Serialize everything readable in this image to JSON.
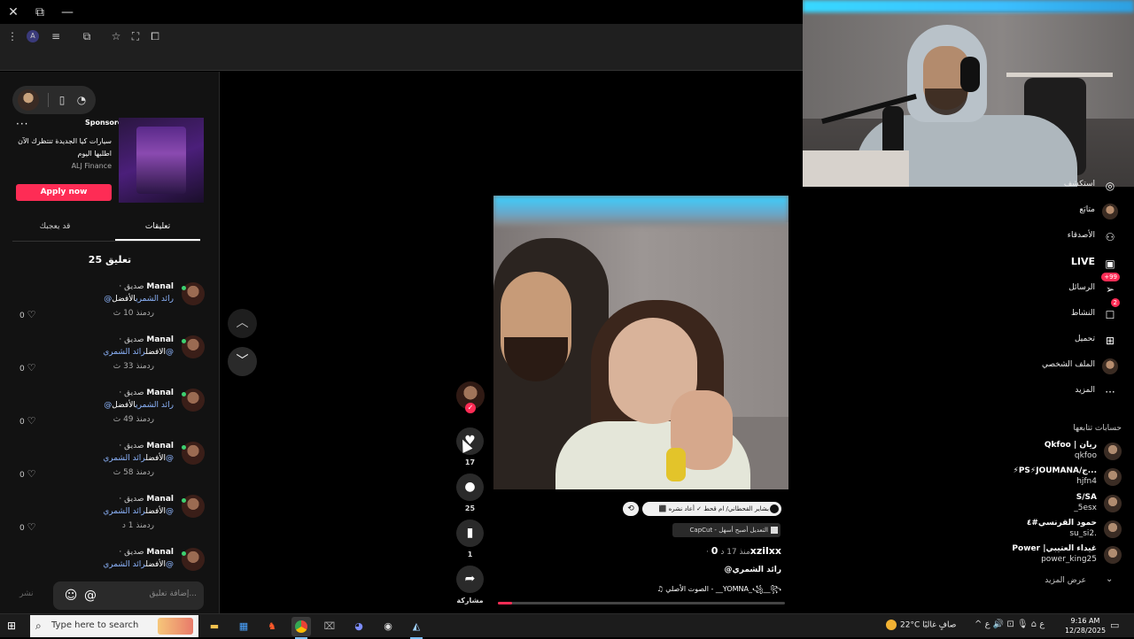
{
  "browser": {
    "close_glyph": "✕",
    "restore_glyph": "⧉",
    "minimize_glyph": "—",
    "menu_glyph": "⋮",
    "toolbar_icons": [
      "profile-icon",
      "media-control-icon",
      "extensions-icon",
      "bookmark-star-icon",
      "screenshot-icon",
      "split-view-icon"
    ]
  },
  "left_panel": {
    "ad": {
      "more": "···",
      "sponsored": "Sponsored",
      "headline": "سيارات كيا الجديدة تنتظرك الآن اطلبها اليوم",
      "brand": "ALJ Finance",
      "cta": "Apply now"
    },
    "tabs": {
      "comments": "تعليقات",
      "you_may_like": "قد يعجبك"
    },
    "comment_count": "25 تعليق",
    "comments": [
      {
        "name": "Manal",
        "relation": "· صديق",
        "text_mention": "@رائد الشمري",
        "text_plain": "الأفضل",
        "order": "plain-first",
        "time": "منذ 10 ث",
        "reply": "رد",
        "likes": "0"
      },
      {
        "name": "Manal",
        "relation": "· صديق",
        "text_mention": "رائد الشمري@",
        "text_plain": "الافضل",
        "order": "mention-first",
        "time": "منذ 33 ث",
        "reply": "رد",
        "likes": "0"
      },
      {
        "name": "Manal",
        "relation": "· صديق",
        "text_mention": "@رائد الشمري",
        "text_plain": "الأفضل",
        "order": "plain-first",
        "time": "منذ 49 ث",
        "reply": "رد",
        "likes": "0"
      },
      {
        "name": "Manal",
        "relation": "· صديق",
        "text_mention": "رائد الشمري@",
        "text_plain": "الأفضل",
        "order": "mention-first",
        "time": "منذ 58 ث",
        "reply": "رد",
        "likes": "0"
      },
      {
        "name": "Manal",
        "relation": "· صديق",
        "text_mention": "رائد الشمري@",
        "text_plain": "الأفضل",
        "order": "mention-first",
        "time": "منذ 1 د",
        "reply": "رد",
        "likes": "0"
      },
      {
        "name": "Manal",
        "relation": "· صديق",
        "text_mention": "رائد الشمري@",
        "text_plain": "الأفضل",
        "order": "mention-first",
        "time": "",
        "reply": "",
        "likes": ""
      }
    ],
    "comment_input_placeholder": "إضافة تعليق...",
    "post_label": "نشر",
    "emoji_glyph": "☺",
    "mention_glyph": "@"
  },
  "video": {
    "actions": {
      "likes": "17",
      "comments": "25",
      "saves": "1",
      "share_label": "مشاركة"
    },
    "repost_text": "⬛ بشاير القحطاني/ ام قحط ✓ أعاد نشره",
    "capcut_text": "CapCut - التعديل أصبح أسهل",
    "author": "0xzilxx",
    "author_time": " · منذ 17 د",
    "mention": "@رائد الشمري",
    "music": "♫  الصوت الأصلي - __YOMNA_꧁__꧂",
    "progress": 0.05
  },
  "right_sidebar": {
    "nav": [
      {
        "label": "استكشف",
        "icon": "explore-icon",
        "glyph": "◎",
        "badge": ""
      },
      {
        "label": "متابَع",
        "icon": "following-avatar-icon",
        "glyph": "●",
        "badge": ""
      },
      {
        "label": "الأصدقاء",
        "icon": "friends-icon",
        "glyph": "⚇",
        "badge": ""
      },
      {
        "label": "LIVE",
        "icon": "live-icon",
        "glyph": "▣",
        "badge": "",
        "big": true
      },
      {
        "label": "الرسائل",
        "icon": "messages-icon",
        "glyph": "➢",
        "badge": "+99"
      },
      {
        "label": "النشاط",
        "icon": "activity-icon",
        "glyph": "☐",
        "badge": "2"
      },
      {
        "label": "تحميل",
        "icon": "upload-icon",
        "glyph": "⊞",
        "badge": ""
      },
      {
        "label": "الملف الشخصي",
        "icon": "profile-avatar-icon",
        "glyph": "●",
        "badge": ""
      },
      {
        "label": "المزيد",
        "icon": "more-icon",
        "glyph": "···",
        "badge": ""
      }
    ],
    "following_title": "حسابات تتابعها",
    "following": [
      {
        "name": "Qkfoo | ريان",
        "username": "qkfoo"
      },
      {
        "name": "⚡PS⚡JOUMANA/ج...",
        "username": "hjfn4"
      },
      {
        "name": "S/SA",
        "username": "_5esx"
      },
      {
        "name": "حمود القرنسي#٤",
        "username": "su_si2."
      },
      {
        "name": "Power |غيداء العتيبي",
        "username": "power_king25"
      }
    ],
    "see_more": "عرض المزيد"
  },
  "taskbar": {
    "search_placeholder": "Type here to search",
    "weather_temp": "22°C",
    "weather_text": "صافٍ غالبًا",
    "tray_text": "^  ع  ⌂  🎙  ⊡  🔊  ع",
    "time": "9:16 AM",
    "date": "12/28/2025",
    "apps": [
      "file-explorer-icon",
      "store-icon",
      "brave-icon",
      "chrome-icon",
      "terminal-icon",
      "discord-icon",
      "obs-icon",
      "steam-icon"
    ]
  }
}
